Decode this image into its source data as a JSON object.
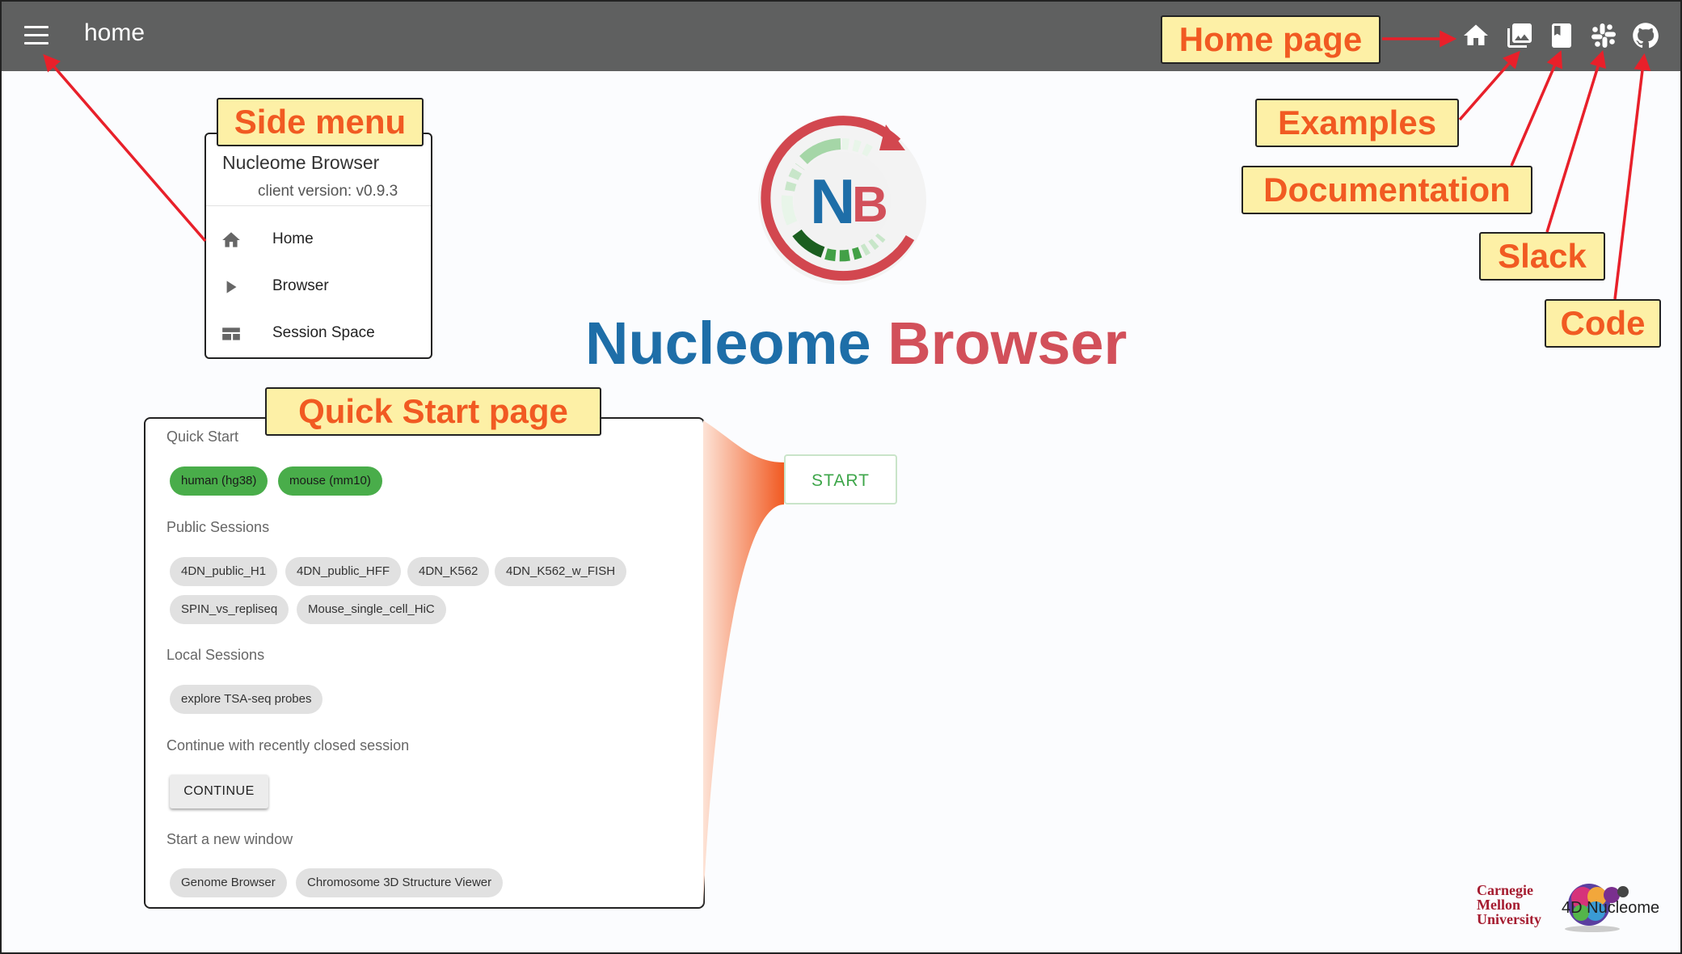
{
  "appbar": {
    "title": "home",
    "icons": [
      "menu-icon",
      "home-icon",
      "image-gallery-icon",
      "book-icon",
      "slack-icon",
      "github-icon"
    ]
  },
  "annotations": {
    "home_page": "Home page",
    "side_menu": "Side menu",
    "examples": "Examples",
    "documentation": "Documentation",
    "slack": "Slack",
    "code": "Code",
    "quick_start_page": "Quick Start page"
  },
  "side_menu": {
    "title": "Nucleome Browser",
    "version": "client version: v0.9.3",
    "items": [
      {
        "label": "Home",
        "icon": "home-icon"
      },
      {
        "label": "Browser",
        "icon": "play-icon"
      },
      {
        "label": "Session Space",
        "icon": "view-panel-icon"
      }
    ]
  },
  "logo": {
    "letters_left": "N",
    "letters_right": "B",
    "title_part1": "Nucleome",
    "title_part2": "Browser"
  },
  "quick_start": {
    "section_quick": "Quick Start",
    "genomes": [
      "human (hg38)",
      "mouse (mm10)"
    ],
    "section_public": "Public Sessions",
    "public_sessions": [
      "4DN_public_H1",
      "4DN_public_HFF",
      "4DN_K562",
      "4DN_K562_w_FISH",
      "SPIN_vs_repliseq",
      "Mouse_single_cell_HiC"
    ],
    "section_local": "Local Sessions",
    "local_sessions": [
      "explore TSA-seq probes"
    ],
    "section_continue": "Continue with recently closed session",
    "continue_label": "CONTINUE",
    "section_new_window": "Start a new window",
    "new_windows": [
      "Genome Browser",
      "Chromosome 3D Structure Viewer"
    ]
  },
  "start_button": "START",
  "footer": {
    "cmu_line1": "Carnegie",
    "cmu_line2": "Mellon",
    "cmu_line3": "University",
    "fourdn": "4D Nucleome"
  },
  "colors": {
    "appbar": "#5f6060",
    "annotation_fill": "#fdf0a6",
    "annotation_text": "#f15a22",
    "arrow": "#e8202a",
    "title_blue": "#1e6ea8",
    "title_red": "#d2505a",
    "chip_green": "#49ad4a",
    "start_green": "#3ea64a"
  }
}
